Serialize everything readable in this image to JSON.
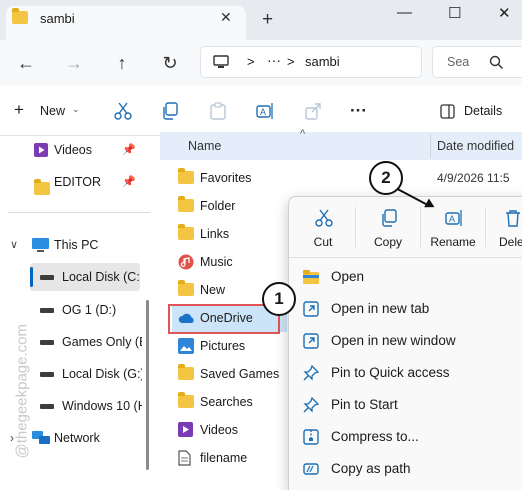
{
  "window": {
    "tab_title": "sambi",
    "close_tab_glyph": "✕",
    "new_tab_glyph": "+",
    "minimize_glyph": "—",
    "maximize_glyph": "☐",
    "close_window_glyph": "✕"
  },
  "nav": {
    "back_glyph": "←",
    "forward_glyph": "→",
    "up_glyph": "↑",
    "refresh_glyph": "↻",
    "breadcrumb_separator": ">",
    "breadcrumb_more": "···",
    "breadcrumb_current": "sambi",
    "search_placeholder": "Sea"
  },
  "command_bar": {
    "new_label": "New",
    "more_glyph": "···",
    "details_label": "Details"
  },
  "sidebar": {
    "pinned": [
      {
        "label": "Videos",
        "icon": "videos-icon"
      },
      {
        "label": "EDITOR",
        "icon": "folder-icon"
      }
    ],
    "this_pc_label": "This PC",
    "drives": [
      {
        "label": "Local Disk (C:)",
        "selected": true
      },
      {
        "label": "OG 1 (D:)"
      },
      {
        "label": "Games Only (E"
      },
      {
        "label": "Local Disk (G:)"
      },
      {
        "label": "Windows 10 (H"
      }
    ],
    "network_label": "Network"
  },
  "file_list": {
    "column_name": "Name",
    "column_date": "Date modified",
    "sort_glyph": "^",
    "first_date": "4/9/2026 11:5",
    "items": [
      {
        "name": "Favorites",
        "icon": "folder-icon"
      },
      {
        "name": "Folder",
        "icon": "folder-icon"
      },
      {
        "name": "Links",
        "icon": "folder-icon"
      },
      {
        "name": "Music",
        "icon": "music-icon"
      },
      {
        "name": "New",
        "icon": "folder-icon"
      },
      {
        "name": "OneDrive",
        "icon": "onedrive-icon",
        "highlighted": true
      },
      {
        "name": "Pictures",
        "icon": "pictures-icon"
      },
      {
        "name": "Saved Games",
        "icon": "folder-icon"
      },
      {
        "name": "Searches",
        "icon": "folder-icon"
      },
      {
        "name": "Videos",
        "icon": "videos-icon"
      },
      {
        "name": "filename",
        "icon": "file-icon"
      }
    ]
  },
  "context_menu": {
    "top_actions": [
      {
        "label": "Cut",
        "icon": "scissors-icon"
      },
      {
        "label": "Copy",
        "icon": "copy-icon"
      },
      {
        "label": "Rename",
        "icon": "rename-icon"
      },
      {
        "label": "Dele",
        "icon": "delete-icon"
      }
    ],
    "items": [
      {
        "label": "Open",
        "icon": "open-icon"
      },
      {
        "label": "Open in new tab",
        "icon": "new-tab-icon"
      },
      {
        "label": "Open in new window",
        "icon": "new-window-icon"
      },
      {
        "label": "Pin to Quick access",
        "icon": "pin-icon"
      },
      {
        "label": "Pin to Start",
        "icon": "pin-icon"
      },
      {
        "label": "Compress to...",
        "icon": "zip-icon"
      },
      {
        "label": "Copy as path",
        "icon": "path-icon"
      }
    ]
  },
  "callouts": {
    "step1": "1",
    "step2": "2"
  },
  "watermark": "@thegeekpage.com",
  "colors": {
    "accent": "#0067c0",
    "highlight_box": "#e05555",
    "selection": "#cce4f7",
    "header_bg": "#e3eefa"
  }
}
